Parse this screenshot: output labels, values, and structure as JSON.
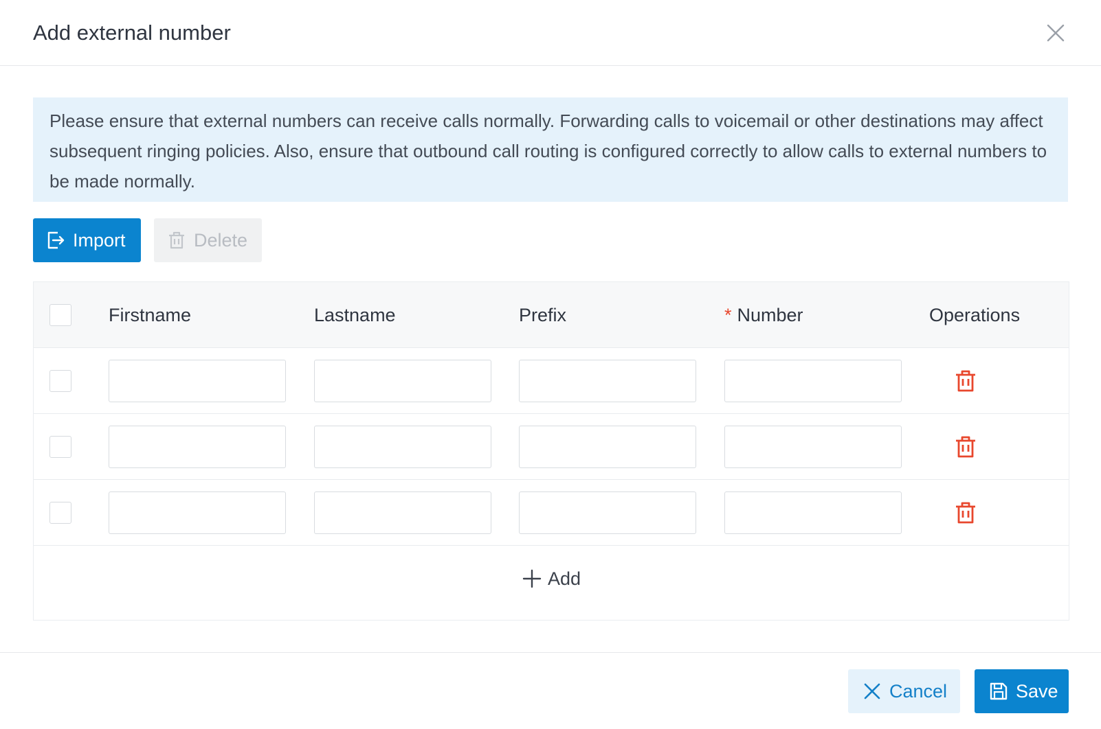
{
  "dialog": {
    "title": "Add external number",
    "close_icon": "close-icon"
  },
  "notice": {
    "text": "Please ensure that external numbers can receive calls normally. Forwarding calls to voicemail or other destinations may affect subsequent ringing policies. Also, ensure that outbound call routing is configured correctly to allow calls to external numbers to be made normally."
  },
  "toolbar": {
    "import_label": "Import",
    "import_icon": "import-icon",
    "delete_label": "Delete",
    "delete_icon": "trash-icon",
    "delete_disabled": true
  },
  "table": {
    "columns": {
      "firstname": "Firstname",
      "lastname": "Lastname",
      "prefix": "Prefix",
      "number_required_mark": "*",
      "number": "Number",
      "operations": "Operations"
    },
    "rows": [
      {
        "firstname": "",
        "lastname": "",
        "prefix": "",
        "number": "",
        "checked": false
      },
      {
        "firstname": "",
        "lastname": "",
        "prefix": "",
        "number": "",
        "checked": false
      },
      {
        "firstname": "",
        "lastname": "",
        "prefix": "",
        "number": "",
        "checked": false
      }
    ],
    "add_label": "Add"
  },
  "footer": {
    "cancel_label": "Cancel",
    "save_label": "Save"
  },
  "colors": {
    "primary": "#0b84cf",
    "danger": "#e8472d",
    "notice_bg": "#e5f2fb"
  }
}
